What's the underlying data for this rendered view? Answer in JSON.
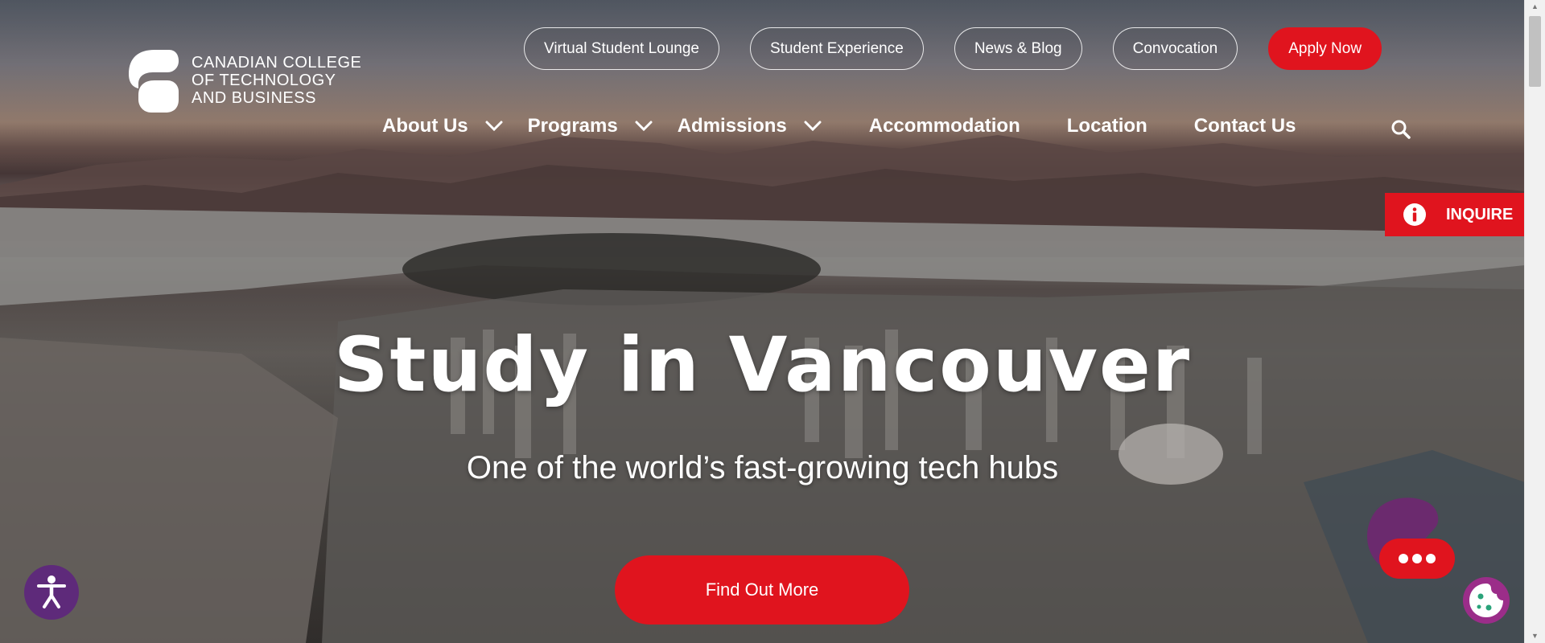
{
  "logo": {
    "line1": "CANADIAN COLLEGE",
    "line2": "OF TECHNOLOGY",
    "line3": "AND BUSINESS"
  },
  "top_links": [
    {
      "label": "Virtual Student Lounge"
    },
    {
      "label": "Student Experience"
    },
    {
      "label": "News & Blog"
    },
    {
      "label": "Convocation"
    },
    {
      "label": "Apply Now"
    }
  ],
  "main_nav": [
    {
      "label": "About Us",
      "has_dropdown": true
    },
    {
      "label": "Programs",
      "has_dropdown": true
    },
    {
      "label": "Admissions",
      "has_dropdown": true
    },
    {
      "label": "Accommodation",
      "has_dropdown": false
    },
    {
      "label": "Location",
      "has_dropdown": false
    },
    {
      "label": "Contact Us",
      "has_dropdown": false
    }
  ],
  "inquire": {
    "label": "INQUIRE"
  },
  "hero": {
    "title": "Study in Vancouver",
    "subtitle": "One of the world’s fast-growing tech hubs",
    "cta_label": "Find Out More"
  },
  "icons": {
    "search": "search-icon",
    "dropdown": "chevron-down-icon",
    "info": "info-icon",
    "accessibility": "accessibility-icon",
    "chat": "chat-icon",
    "cookie": "cookie-icon"
  },
  "colors": {
    "brand_red": "#e0141e",
    "accessibility_purple": "#5e2a7a",
    "chat_purple": "#6b2a6e",
    "cookie_purple": "#9b2d89"
  }
}
